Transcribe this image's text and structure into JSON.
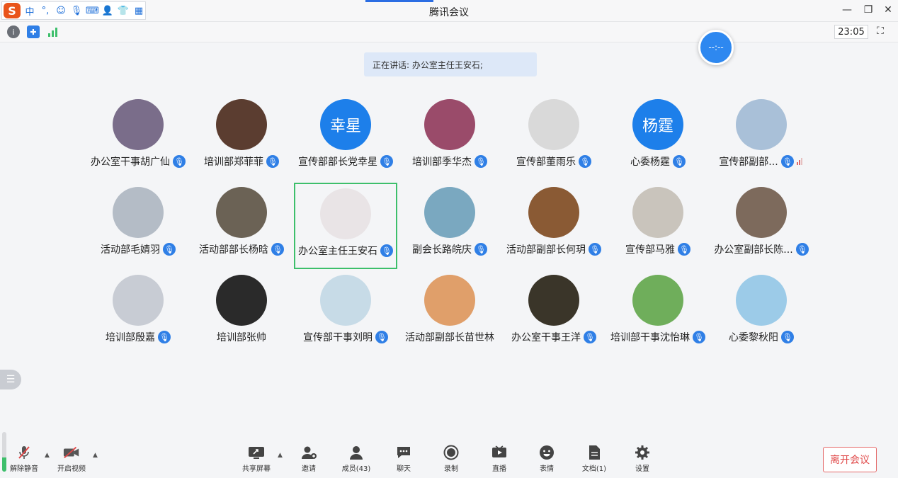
{
  "window": {
    "title": "腾讯会议"
  },
  "ime": {
    "items": [
      "中",
      "°,",
      "☺",
      "🎙",
      "⌨",
      "👤",
      "👕",
      "▦"
    ]
  },
  "status": {
    "clock": "23:05"
  },
  "floating_timer": {
    "text": "--:--"
  },
  "speaking": {
    "text": "正在讲话: 办公室主任王安石;"
  },
  "participants": [
    {
      "name": "办公室干事胡广仙",
      "avatar_text": "",
      "color": "#7a6d8a"
    },
    {
      "name": "培训部郑菲菲",
      "avatar_text": "",
      "color": "#5b3d30"
    },
    {
      "name": "宣传部部长党幸星",
      "avatar_text": "幸星",
      "color": "#1d7fea"
    },
    {
      "name": "培训部季华杰",
      "avatar_text": "",
      "color": "#9a4b6a"
    },
    {
      "name": "宣传部董雨乐",
      "avatar_text": "",
      "color": "#d9d9d9"
    },
    {
      "name": "心委杨霆",
      "avatar_text": "杨霆",
      "color": "#1d7fea"
    },
    {
      "name": "宣传部副部...",
      "avatar_text": "",
      "color": "#a9c0d8"
    },
    {
      "name": "活动部毛婧羽",
      "avatar_text": "",
      "color": "#b4bcc6"
    },
    {
      "name": "活动部部长杨晗",
      "avatar_text": "",
      "color": "#6b6255"
    },
    {
      "name": "办公室主任王安石",
      "avatar_text": "",
      "color": "#e9e4e6"
    },
    {
      "name": "副会长路皖庆",
      "avatar_text": "",
      "color": "#7aa8c0"
    },
    {
      "name": "活动部副部长何玥",
      "avatar_text": "",
      "color": "#8a5a34"
    },
    {
      "name": "宣传部马雅",
      "avatar_text": "",
      "color": "#c9c4bc"
    },
    {
      "name": "办公室副部长陈...",
      "avatar_text": "",
      "color": "#7d6a5c"
    },
    {
      "name": "培训部殷嘉",
      "avatar_text": "",
      "color": "#c8ccd4"
    },
    {
      "name": "培训部张帅",
      "avatar_text": "",
      "color": "#2a2a2a"
    },
    {
      "name": "宣传部干事刘明",
      "avatar_text": "",
      "color": "#c7dbe7"
    },
    {
      "name": "活动部副部长苗世林",
      "avatar_text": "",
      "color": "#e09f6a"
    },
    {
      "name": "办公室干事王洋",
      "avatar_text": "",
      "color": "#3a3529"
    },
    {
      "name": "培训部干事沈怡琳",
      "avatar_text": "",
      "color": "#6fae5b"
    },
    {
      "name": "心委黎秋阳",
      "avatar_text": "",
      "color": "#9ccbe8"
    }
  ],
  "toolbar": {
    "unmute": "解除静音",
    "start_video": "开启视频",
    "share_screen": "共享屏幕",
    "invite": "邀请",
    "members": "成员(43)",
    "chat": "聊天",
    "record": "录制",
    "live": "直播",
    "emoji": "表情",
    "docs": "文档(1)",
    "settings": "设置",
    "leave": "离开会议"
  },
  "colors": {
    "accent": "#2f7fe6",
    "active_border": "#3dbf6b",
    "leave": "#e04848"
  }
}
